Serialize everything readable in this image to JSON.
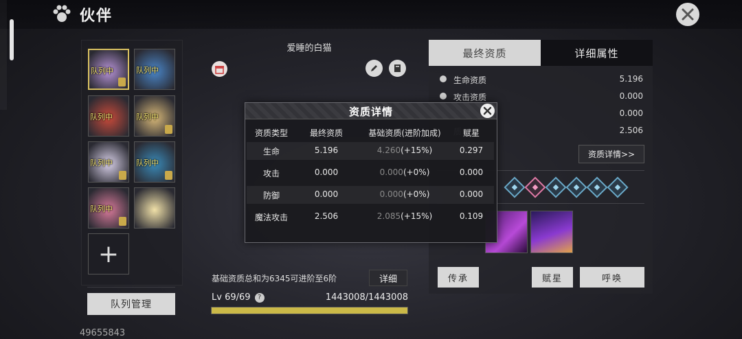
{
  "header": {
    "title": "伙伴"
  },
  "partners": {
    "in_team_label": "队列中",
    "slots": [
      {
        "team": true,
        "selected": true,
        "locked": true,
        "color": "#b894d8"
      },
      {
        "team": true,
        "selected": false,
        "locked": false,
        "color": "#4a86c8"
      },
      {
        "team": true,
        "selected": false,
        "locked": false,
        "color": "#c84a3a"
      },
      {
        "team": true,
        "selected": false,
        "locked": true,
        "color": "#d8b878"
      },
      {
        "team": true,
        "selected": false,
        "locked": true,
        "color": "#d8d0e8"
      },
      {
        "team": true,
        "selected": false,
        "locked": true,
        "color": "#3a8ab8"
      },
      {
        "team": true,
        "selected": false,
        "locked": true,
        "color": "#d87a9a"
      },
      {
        "team": false,
        "selected": false,
        "locked": false,
        "color": "#f0e0a8"
      }
    ],
    "add_symbol": "+",
    "team_manage_label": "队列管理",
    "power": "49655843"
  },
  "pet": {
    "name": "爱睡的白猫",
    "advance_text": "基础资质总和为6345可进阶至6阶",
    "detail_label": "详细",
    "level": "Lv 69/69",
    "help": "?",
    "exp": "1443008/1443008",
    "exp_fraction": 1.0
  },
  "right_panel": {
    "tabs": [
      "最终资质",
      "详细属性"
    ],
    "stats": [
      {
        "label": "生命资质",
        "value": "5.196"
      },
      {
        "label": "攻击资质",
        "value": "0.000"
      },
      {
        "label": "",
        "value": "0.000"
      },
      {
        "label": "质",
        "value": "2.506"
      }
    ],
    "detail_button": "资质详情>>",
    "buttons": {
      "inherit": "传承",
      "star": "赋星",
      "summon": "呼唤"
    }
  },
  "modal": {
    "title": "资质详情",
    "headers": [
      "资质类型",
      "最终资质",
      "基础资质(进阶加成)",
      "赋星"
    ],
    "rows": [
      {
        "type": "生命",
        "final": "5.196",
        "base": "4.260",
        "bonus": "(+15%)",
        "star": "0.297"
      },
      {
        "type": "攻击",
        "final": "0.000",
        "base": "0.000",
        "bonus": "(+0%)",
        "star": "0.000"
      },
      {
        "type": "防御",
        "final": "0.000",
        "base": "0.000",
        "bonus": "(+0%)",
        "star": "0.000"
      },
      {
        "type": "魔法攻击",
        "final": "2.506",
        "base": "2.085",
        "bonus": "(+15%)",
        "star": "0.109"
      }
    ]
  },
  "colors": {
    "accent_gold": "#cbb948",
    "selected_border": "#d8c060",
    "team_tag": "#f0e070"
  }
}
